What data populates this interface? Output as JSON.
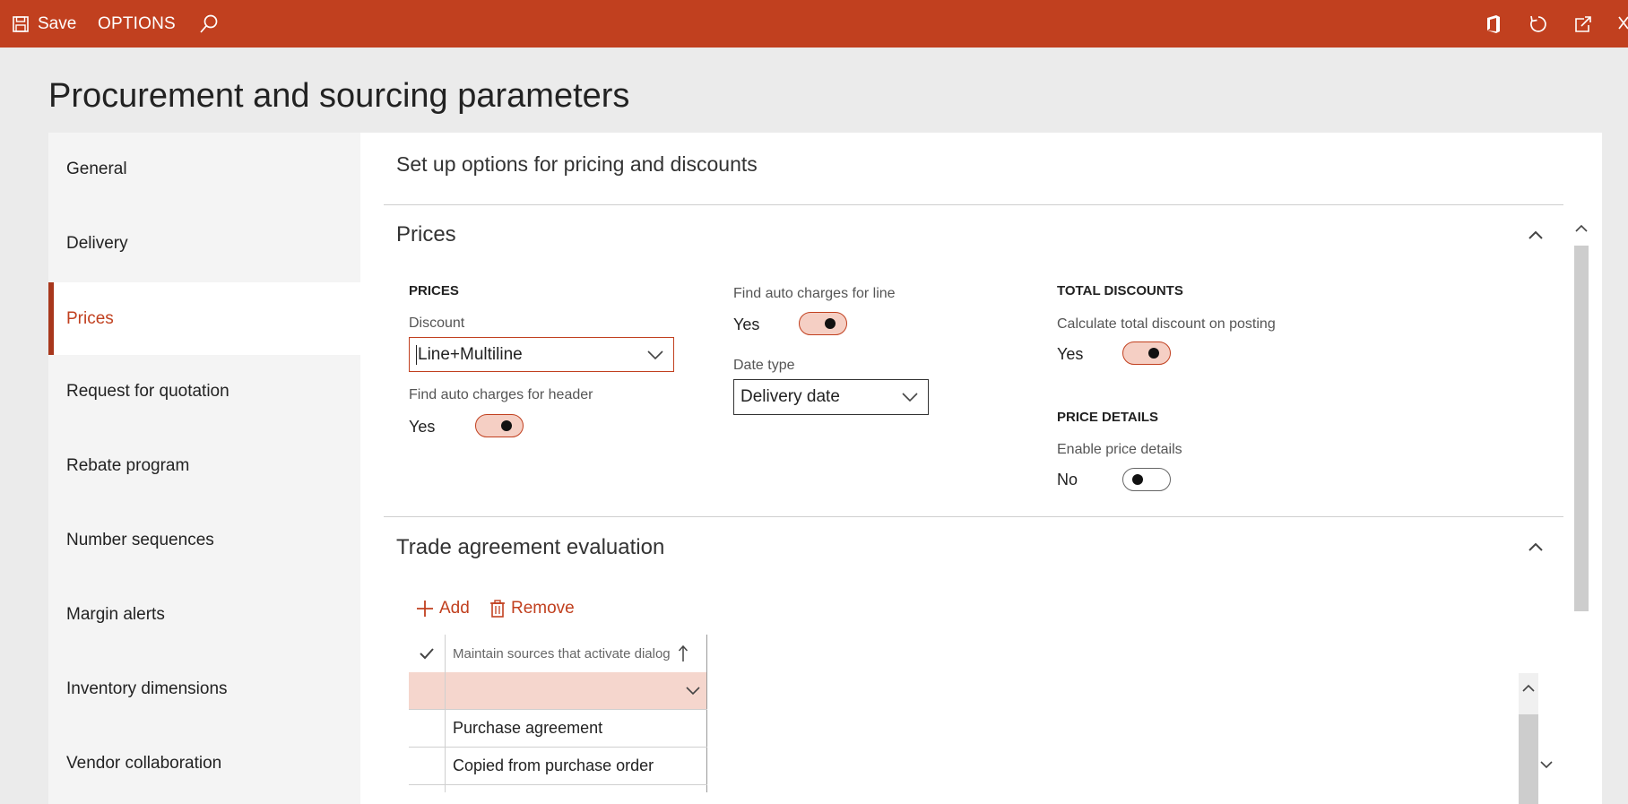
{
  "topbar": {
    "save_label": "Save",
    "options_label": "OPTIONS",
    "icons": [
      "save-icon",
      "search-icon",
      "office-icon",
      "refresh-icon",
      "popout-icon",
      "close-icon"
    ]
  },
  "page": {
    "title": "Procurement and sourcing parameters"
  },
  "nav": {
    "items": [
      {
        "label": "General"
      },
      {
        "label": "Delivery"
      },
      {
        "label": "Prices"
      },
      {
        "label": "Request for quotation"
      },
      {
        "label": "Rebate program"
      },
      {
        "label": "Number sequences"
      },
      {
        "label": "Margin alerts"
      },
      {
        "label": "Inventory dimensions"
      },
      {
        "label": "Vendor collaboration"
      }
    ],
    "active": "Prices"
  },
  "main": {
    "heading": "Set up options for pricing and discounts",
    "prices": {
      "title": "Prices",
      "prices_group": "PRICES",
      "discount_label": "Discount",
      "discount_value": "Line+Multiline",
      "auto_header_label": "Find auto charges for header",
      "auto_header_value": "Yes",
      "auto_line_label": "Find auto charges for line",
      "auto_line_value": "Yes",
      "date_type_label": "Date type",
      "date_type_value": "Delivery date",
      "total_discounts_group": "TOTAL DISCOUNTS",
      "calc_total_label": "Calculate total discount on posting",
      "calc_total_value": "Yes",
      "price_details_group": "PRICE DETAILS",
      "enable_details_label": "Enable price details",
      "enable_details_value": "No"
    },
    "trade": {
      "title": "Trade agreement evaluation",
      "add_label": "Add",
      "remove_label": "Remove",
      "column_header": "Maintain sources that activate dialog",
      "rows": [
        "",
        "Purchase agreement",
        "Copied from purchase order"
      ]
    }
  },
  "colors": {
    "accent": "#c1401f",
    "selected_row": "#f5d6cd",
    "toggle_on": "#f5cfc4"
  }
}
